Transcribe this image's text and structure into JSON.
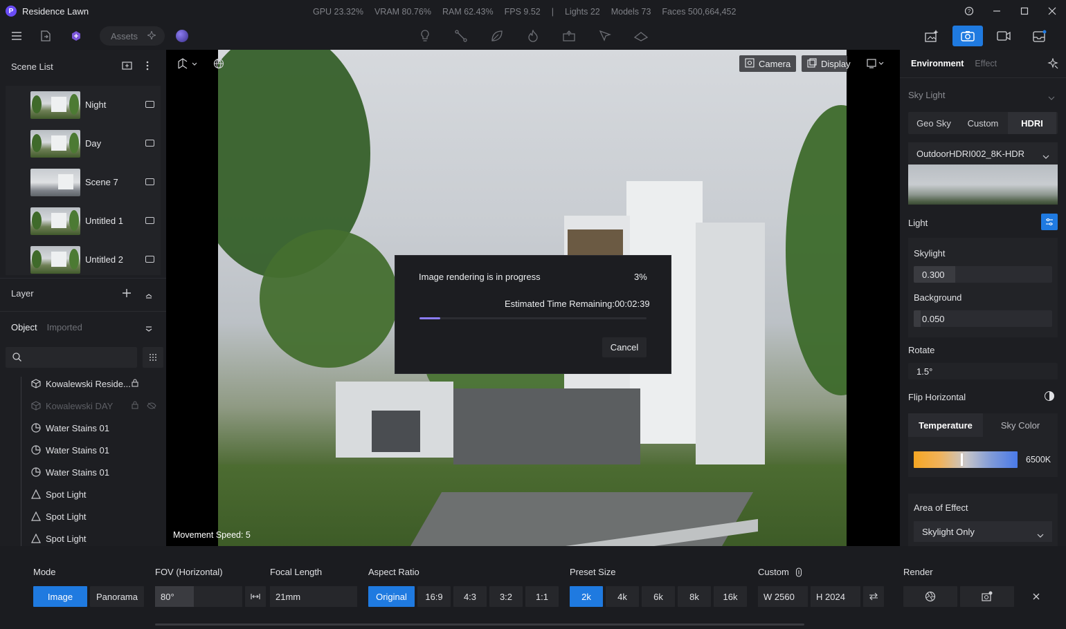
{
  "app": {
    "title": "Residence Lawn",
    "stats": {
      "gpu": "GPU 23.32%",
      "vram": "VRAM 80.76%",
      "ram": "RAM 62.43%",
      "fps": "FPS 9.52",
      "separator": "|",
      "lights": "Lights 22",
      "models": "Models 73",
      "faces": "Faces 500,664,452"
    }
  },
  "toolbar": {
    "assets_label": "Assets",
    "active_right_tool": "camera-render"
  },
  "scene_list": {
    "header": "Scene List",
    "items": [
      {
        "name": "Night"
      },
      {
        "name": "Day"
      },
      {
        "name": "Scene 7"
      },
      {
        "name": "Untitled 1"
      },
      {
        "name": "Untitled 2"
      }
    ]
  },
  "layer": {
    "header": "Layer",
    "tab_object": "Object",
    "tab_imported": "Imported",
    "search_placeholder": "",
    "objects": [
      {
        "name": "Kowalewski Reside...",
        "icon": "cube-icon",
        "locked": true,
        "hidden": false
      },
      {
        "name": "Kowalewski DAY",
        "icon": "cube-icon",
        "locked": true,
        "hidden": true
      },
      {
        "name": "Water Stains 01",
        "icon": "decal-icon",
        "locked": false,
        "hidden": false
      },
      {
        "name": "Water Stains 01",
        "icon": "decal-icon",
        "locked": false,
        "hidden": false
      },
      {
        "name": "Water Stains 01",
        "icon": "decal-icon",
        "locked": false,
        "hidden": false
      },
      {
        "name": "Spot Light",
        "icon": "spotlight-icon",
        "locked": false,
        "hidden": false
      },
      {
        "name": "Spot Light",
        "icon": "spotlight-icon",
        "locked": false,
        "hidden": false
      },
      {
        "name": "Spot Light",
        "icon": "spotlight-icon",
        "locked": false,
        "hidden": false
      }
    ]
  },
  "viewport": {
    "camera_label": "Camera",
    "display_label": "Display",
    "movement_speed": "Movement Speed: 5"
  },
  "render_dialog": {
    "title": "Image rendering is in progress",
    "percent_text": "3%",
    "progress": 0.03,
    "eta": "Estimated Time Remaining:00:02:39",
    "cancel_label": "Cancel"
  },
  "right_panel": {
    "tab_environment": "Environment",
    "tab_effect": "Effect",
    "sky_light_header": "Sky Light",
    "sky_tabs": [
      "Geo Sky",
      "Custom",
      "HDRI"
    ],
    "sky_tab_active": "HDRI",
    "hdri_name": "OutdoorHDRI002_8K-HDR",
    "light_header": "Light",
    "skylight_label": "Skylight",
    "skylight_value": "0.300",
    "skylight_fraction": 0.3,
    "background_label": "Background",
    "background_value": "0.050",
    "background_fraction": 0.05,
    "rotate_label": "Rotate",
    "rotate_value": "1.5°",
    "flip_label": "Flip Horizontal",
    "temp_tab": "Temperature",
    "skycolor_tab": "Sky Color",
    "temperature_value": "6500K",
    "temperature_fraction": 0.45,
    "area_label": "Area of Effect",
    "area_value": "Skylight Only"
  },
  "bottom": {
    "mode_label": "Mode",
    "mode_options": [
      "Image",
      "Panorama"
    ],
    "mode_active": "Image",
    "fov_label": "FOV (Horizontal)",
    "fov_value": "80°",
    "focal_label": "Focal Length",
    "focal_value": "21mm",
    "aspect_label": "Aspect Ratio",
    "aspect_options": [
      "Original",
      "16:9",
      "4:3",
      "3:2",
      "1:1"
    ],
    "aspect_active": "Original",
    "preset_label": "Preset Size",
    "preset_options": [
      "2k",
      "4k",
      "6k",
      "8k",
      "16k"
    ],
    "preset_active": "2k",
    "custom_label": "Custom",
    "width_value": "W  2560",
    "height_value": "H  2024",
    "render_label": "Render"
  },
  "colors": {
    "accent": "#1f7ae0",
    "progress": "#8b7cf7",
    "panel_bg": "#1d1e22"
  }
}
